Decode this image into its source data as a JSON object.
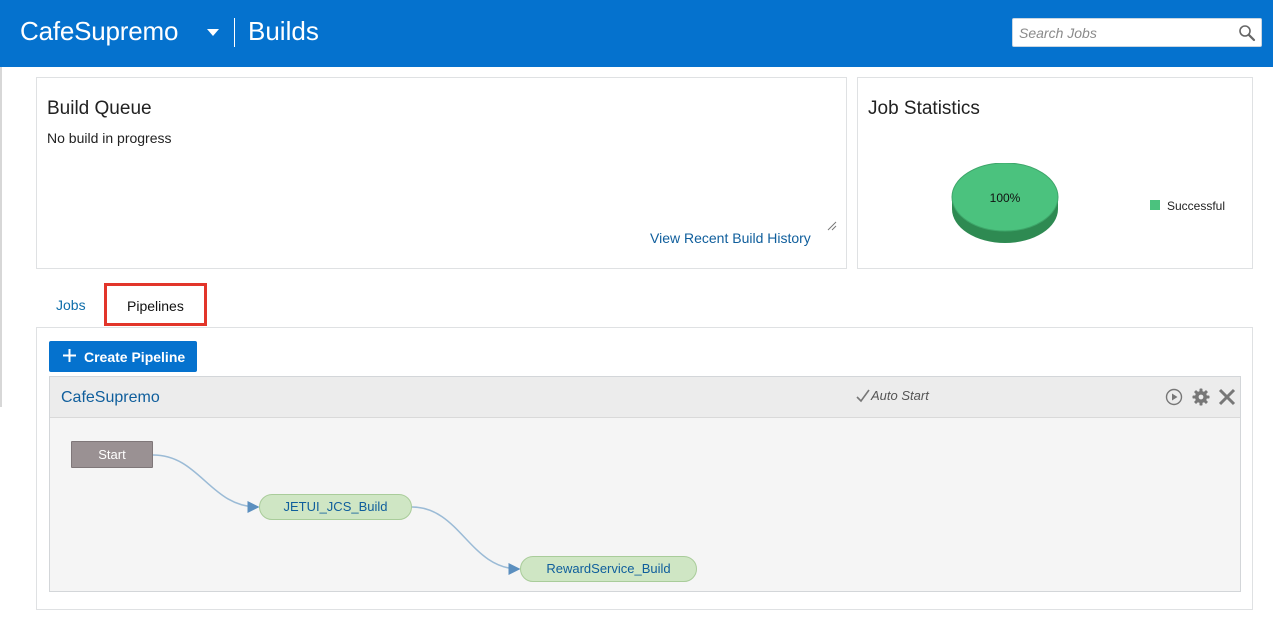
{
  "header": {
    "app_name": "CafeSupremo",
    "section": "Builds",
    "search_placeholder": "Search Jobs"
  },
  "build_queue": {
    "title": "Build Queue",
    "status": "No build in progress",
    "history_link": "View Recent Build History"
  },
  "job_statistics": {
    "title": "Job Statistics",
    "legend_label": "Successful",
    "legend_color": "#4bc27e"
  },
  "chart_data": {
    "type": "pie",
    "series": [
      {
        "name": "Successful",
        "values": [
          100
        ]
      }
    ],
    "categories": [
      "Successful"
    ],
    "data_labels": [
      "100%"
    ]
  },
  "tabs": {
    "jobs": "Jobs",
    "pipelines": "Pipelines",
    "active": "Pipelines"
  },
  "pipelines": {
    "create_button": "Create Pipeline",
    "card": {
      "name": "CafeSupremo",
      "auto_start": "Auto Start",
      "icons": [
        "play-icon",
        "gear-icon",
        "close-icon"
      ],
      "nodes": [
        {
          "label": "Start"
        },
        {
          "label": "JETUI_JCS_Build"
        },
        {
          "label": "RewardService_Build"
        }
      ]
    }
  },
  "colors": {
    "header_bg": "#0572ce",
    "link": "#0f5e9c",
    "highlight": "#e2352a",
    "job_node": "#cfe6c4",
    "start_node": "#9a9193"
  }
}
